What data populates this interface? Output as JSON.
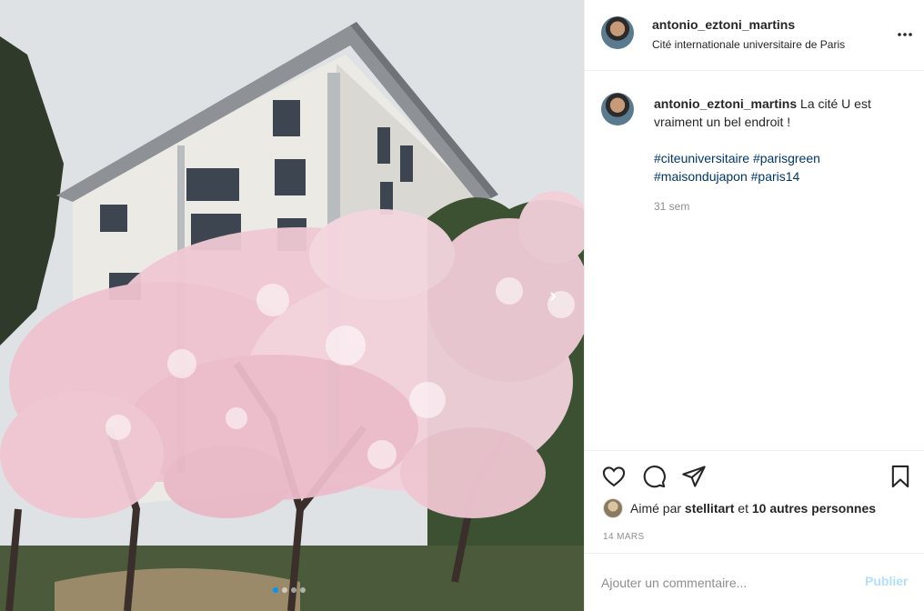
{
  "post": {
    "username": "antonio_eztoni_martins",
    "location": "Cité internationale universitaire de Paris",
    "caption_text": "La cité U est vraiment un bel endroit !",
    "hashtags": [
      "#citeuniversitaire",
      "#parisgreen",
      "#maisondujapon",
      "#paris14"
    ],
    "time_ago": "31 sem",
    "date": "14 MARS",
    "liked_prefix": "Aimé par",
    "liked_user": "stellitart",
    "liked_and": "et",
    "liked_others": "10 autres personnes"
  },
  "carousel": {
    "total": 4,
    "active_index": 0
  },
  "comment": {
    "placeholder": "Ajouter un commentaire...",
    "publish_label": "Publier"
  },
  "icons": {
    "more": "more-horizontal-icon",
    "like": "heart-icon",
    "comment": "comment-bubble-icon",
    "share": "paper-plane-icon",
    "save": "bookmark-icon",
    "next": "chevron-right-icon"
  },
  "colors": {
    "link": "#00376b",
    "accent": "#0095f6",
    "muted": "#8e8e8e",
    "publish_disabled": "#b2dffc"
  }
}
